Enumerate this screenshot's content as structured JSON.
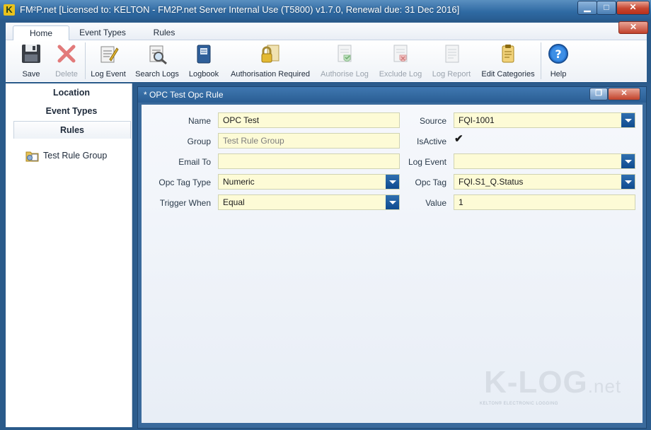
{
  "window": {
    "logo_letter": "K",
    "title": "FM²P.net [Licensed to: KELTON - FM2P.net Server Internal Use (T5800) v1.7.0, Renewal due: 31 Dec 2016]",
    "min_glyph": "▁",
    "max_glyph": "□",
    "close_glyph": "✕"
  },
  "ribbon": {
    "tabs": [
      "Home",
      "Event Types",
      "Rules"
    ],
    "active_tab": "Home",
    "close_glyph": "✕",
    "buttons": [
      {
        "label": "Save",
        "icon": "save-icon",
        "enabled": true
      },
      {
        "label": "Delete",
        "icon": "delete-icon",
        "enabled": false
      },
      {
        "label": "Log Event",
        "icon": "log-event-icon",
        "enabled": true
      },
      {
        "label": "Search Logs",
        "icon": "search-logs-icon",
        "enabled": true
      },
      {
        "label": "Logbook",
        "icon": "logbook-icon",
        "enabled": true
      },
      {
        "label": "Authorisation Required",
        "icon": "lock-icon",
        "enabled": true
      },
      {
        "label": "Authorise Log",
        "icon": "authorise-log-icon",
        "enabled": false
      },
      {
        "label": "Exclude Log",
        "icon": "exclude-log-icon",
        "enabled": false
      },
      {
        "label": "Log Report",
        "icon": "log-report-icon",
        "enabled": false
      },
      {
        "label": "Edit Categories",
        "icon": "edit-categories-icon",
        "enabled": true
      },
      {
        "label": "Help",
        "icon": "help-icon",
        "enabled": true
      }
    ]
  },
  "sidebar": {
    "nav": [
      "Location",
      "Event Types",
      "Rules"
    ],
    "active": "Rules",
    "tree_items": [
      {
        "label": "Test Rule Group",
        "icon": "rule-group-icon"
      }
    ]
  },
  "document": {
    "title": "* OPC Test Opc Rule",
    "restore_glyph": "❐",
    "close_glyph": "✕",
    "form": {
      "name": {
        "label": "Name",
        "value": "OPC Test"
      },
      "group": {
        "label": "Group",
        "placeholder": "Test Rule Group"
      },
      "email_to": {
        "label": "Email To",
        "value": ""
      },
      "opc_tag_type": {
        "label": "Opc Tag Type",
        "value": "Numeric"
      },
      "trigger_when": {
        "label": "Trigger When",
        "value": "Equal"
      },
      "source": {
        "label": "Source",
        "value": "FQI-1001"
      },
      "is_active": {
        "label": "IsActive",
        "checked": true,
        "glyph": "✔"
      },
      "log_event": {
        "label": "Log Event",
        "value": ""
      },
      "opc_tag": {
        "label": "Opc Tag",
        "value": "FQI.S1_Q.Status"
      },
      "value": {
        "label": "Value",
        "value": "1"
      }
    }
  },
  "watermark": {
    "brand": "K-LOG",
    "suffix": ".net",
    "tagline": "KELTON® ELECTRONIC LOGGING"
  },
  "colors": {
    "field_bg": "#fdfbd6",
    "dropdown_button": "#0f4b8f",
    "titlebar": "#2f6aa3"
  }
}
